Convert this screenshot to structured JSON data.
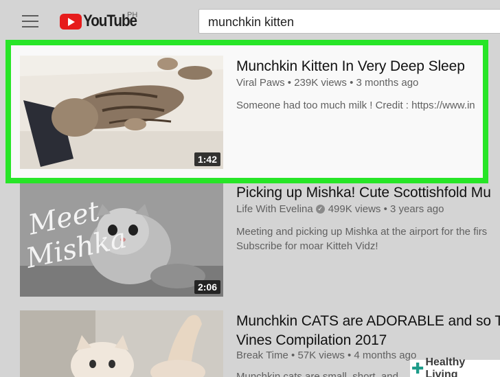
{
  "header": {
    "menu_icon": "hamburger-menu-icon",
    "logo_text": "YouTube",
    "logo_region": "PH",
    "search_value": "munchkin kitten"
  },
  "results": [
    {
      "title": "Munchkin Kitten In Very Deep Sleep",
      "channel": "Viral Paws",
      "views": "239K views",
      "age": "3 months ago",
      "description": [
        "Someone had too much milk ! Credit : https://www.in"
      ],
      "duration": "1:42",
      "highlighted": true
    },
    {
      "title": "Picking up Mishka! Cute Scottishfold Mu",
      "channel": "Life With Evelina",
      "verified": true,
      "views": "499K views",
      "age": "3 years ago",
      "description": [
        "Meeting and picking up Mishka at the airport for the firs",
        "Subscribe for moar Kitteh Vidz!"
      ],
      "thumb_text_1": "Meet",
      "thumb_text_2": "Mishka",
      "duration": "2:06"
    },
    {
      "title_line1": "Munchkin CATS are ADORABLE and so T",
      "title_line2": "Vines Compilation 2017",
      "channel": "Break Time",
      "views": "57K views",
      "age": "4 months ago",
      "description": [
        "Munchkin cats are small, short, and"
      ]
    }
  ],
  "watermark": {
    "text": "Healthy Living",
    "icon": "plus-cross-icon"
  },
  "colors": {
    "highlight": "#27e527",
    "logo_red": "#e61c1c",
    "background": "#d4d4d4"
  }
}
